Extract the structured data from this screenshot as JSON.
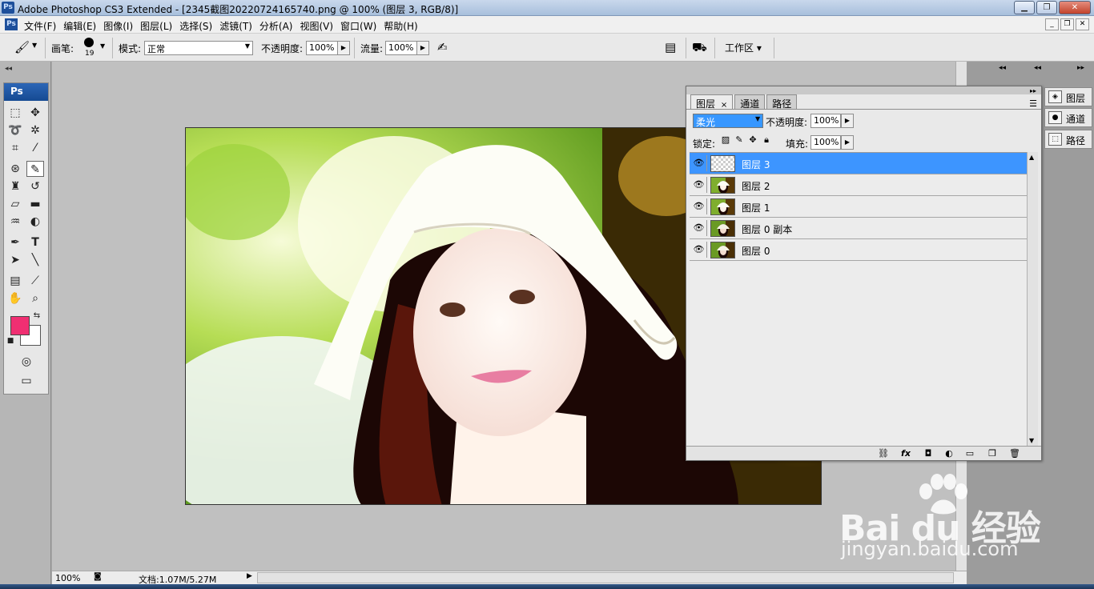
{
  "titlebar": {
    "logo": "Ps",
    "title": "Adobe Photoshop CS3 Extended - [2345截图20220724165740.png @ 100% (图层 3, RGB/8)]",
    "minimize": "▁",
    "maximize": "❐",
    "close": "✕"
  },
  "menubar": {
    "logo": "Ps",
    "items": [
      "文件(F)",
      "编辑(E)",
      "图像(I)",
      "图层(L)",
      "选择(S)",
      "滤镜(T)",
      "分析(A)",
      "视图(V)",
      "窗口(W)",
      "帮助(H)"
    ],
    "mdi_minimize": "_",
    "mdi_restore": "❐",
    "mdi_close": "✕"
  },
  "options": {
    "brush_label": "画笔:",
    "brush_size": "19",
    "mode_label": "模式:",
    "mode_value": "正常",
    "opacity_label": "不透明度:",
    "opacity_value": "100%",
    "flow_label": "流量:",
    "flow_value": "100%",
    "workspace_label": "工作区 ▾"
  },
  "toolbox": {
    "title": "Ps",
    "foreground_color": "#f02f72",
    "background_color": "#ffffff"
  },
  "statusbar": {
    "zoom": "100%",
    "doc_info": "文档:1.07M/5.27M"
  },
  "right_dock": {
    "items": [
      {
        "label": "图层",
        "icon": "layers-icon"
      },
      {
        "label": "通道",
        "icon": "channels-icon"
      },
      {
        "label": "路径",
        "icon": "paths-icon"
      }
    ]
  },
  "layers_panel": {
    "tabs": [
      "图层",
      "通道",
      "路径"
    ],
    "tab_close": "×",
    "blend_mode": "柔光",
    "opacity_label": "不透明度:",
    "opacity_value": "100%",
    "lock_label": "锁定:",
    "fill_label": "填充:",
    "fill_value": "100%",
    "layers": [
      {
        "name": "图层 3",
        "selected": true,
        "transparent": true
      },
      {
        "name": "图层 2",
        "selected": false,
        "transparent": false
      },
      {
        "name": "图层 1",
        "selected": false,
        "transparent": false
      },
      {
        "name": "图层 0 副本",
        "selected": false,
        "transparent": false
      },
      {
        "name": "图层 0",
        "selected": false,
        "transparent": false
      }
    ]
  },
  "watermark": {
    "brand": "Bai du 经验",
    "url": "jingyan.baidu.com"
  }
}
